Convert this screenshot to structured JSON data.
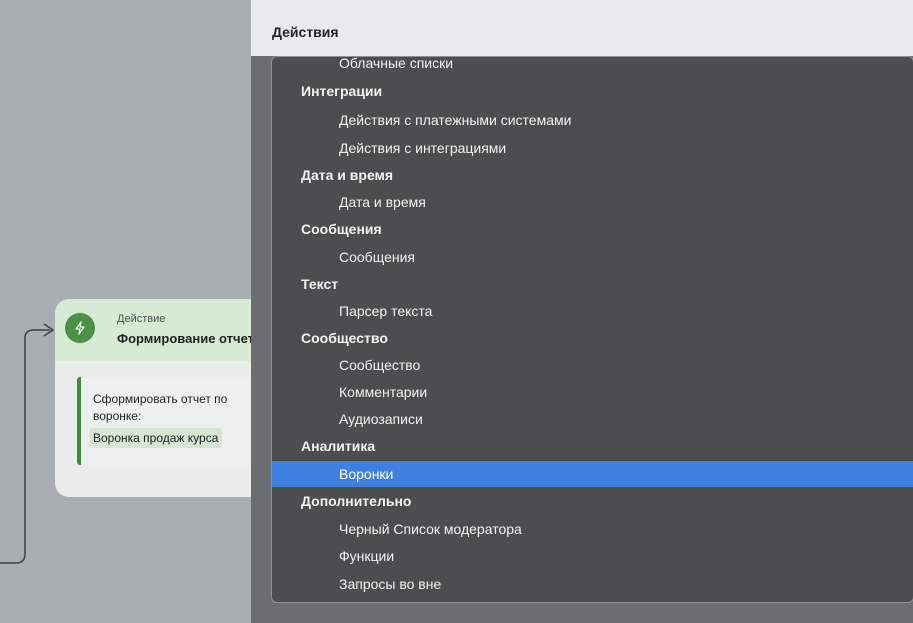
{
  "editor": {
    "node": {
      "type_label": "Действие",
      "title": "Формирование отчета",
      "body_text": "Сформировать отчет по",
      "body_text_2": "воронке:",
      "tag": "Воронка продаж курса"
    }
  },
  "panel": {
    "label": "Действия",
    "dropdown": {
      "options": [
        {
          "label": "Облачные списки",
          "kind": "item"
        },
        {
          "label": "Интеграции",
          "kind": "group"
        },
        {
          "label": "Действия с платежными системами",
          "kind": "item"
        },
        {
          "label": "Действия с интеграциями",
          "kind": "item"
        },
        {
          "label": "Дата и время",
          "kind": "group"
        },
        {
          "label": "Дата и время",
          "kind": "item"
        },
        {
          "label": "Сообщения",
          "kind": "group"
        },
        {
          "label": "Сообщения",
          "kind": "item"
        },
        {
          "label": "Текст",
          "kind": "group"
        },
        {
          "label": "Парсер текста",
          "kind": "item"
        },
        {
          "label": "Сообщество",
          "kind": "group"
        },
        {
          "label": "Сообщество",
          "kind": "item"
        },
        {
          "label": "Комментарии",
          "kind": "item"
        },
        {
          "label": "Аудиозаписи",
          "kind": "item"
        },
        {
          "label": "Аналитика",
          "kind": "group"
        },
        {
          "label": "Воронки",
          "kind": "item",
          "selected": true
        },
        {
          "label": "Дополнительно",
          "kind": "group"
        },
        {
          "label": "Черный Список модератора",
          "kind": "item"
        },
        {
          "label": "Функции",
          "kind": "item"
        },
        {
          "label": "Запросы во вне",
          "kind": "item"
        }
      ]
    }
  },
  "colors": {
    "selection": "#3f7fe0",
    "node_accent": "#4a9146"
  }
}
